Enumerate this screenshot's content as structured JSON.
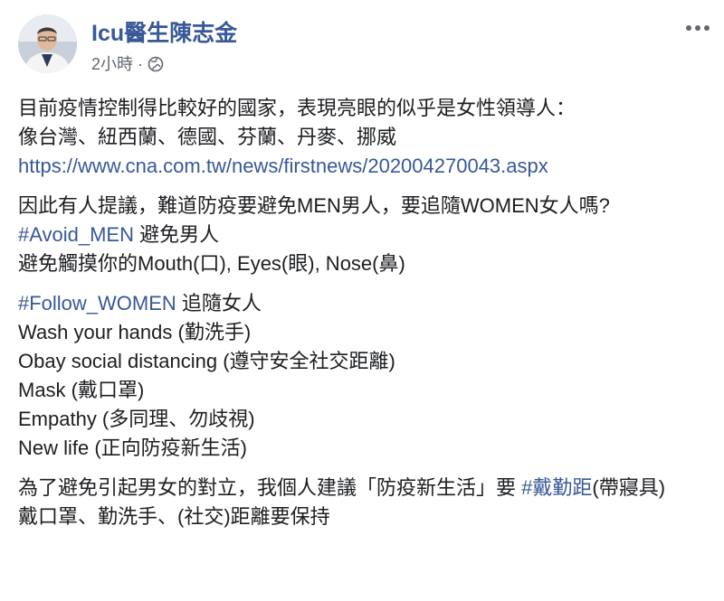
{
  "post": {
    "author": "Icu醫生陳志金",
    "time": "2小時",
    "separator": "·",
    "more_icon": "more-horizontal-icon",
    "privacy_icon": "globe-icon",
    "p1": {
      "line1": "目前疫情控制得比較好的國家，表現亮眼的似乎是女性領導人：",
      "line2": "像台灣、紐西蘭、德國、芬蘭、丹麥、挪威",
      "link": "https://www.cna.com.tw/news/firstnews/202004270043.aspx"
    },
    "p2": {
      "line1": "因此有人提議，難道防疫要避免MEN男人，要追隨WOMEN女人嗎?",
      "tag": "#Avoid_MEN",
      "tag_text": " 避免男人",
      "line3": "避免觸摸你的Mouth(口), Eyes(眼), Nose(鼻)"
    },
    "p3": {
      "tag": "#Follow_WOMEN",
      "tag_text": " 追隨女人",
      "items": [
        "Wash your hands (勤洗手)",
        "Obay social distancing (遵守安全社交距離)",
        "Mask (戴口罩)",
        "Empathy (多同理、勿歧視)",
        "New life (正向防疫新生活)"
      ]
    },
    "p4": {
      "text_before": "為了避免引起男女的對立，我個人建議「防疫新生活」要 ",
      "tag": "#戴勤距",
      "text_after": "(帶寢具)",
      "line2": "戴口罩、勤洗手、(社交)距離要保持"
    }
  },
  "colors": {
    "link": "#385898",
    "text": "#1c1e21",
    "meta": "#606770"
  }
}
